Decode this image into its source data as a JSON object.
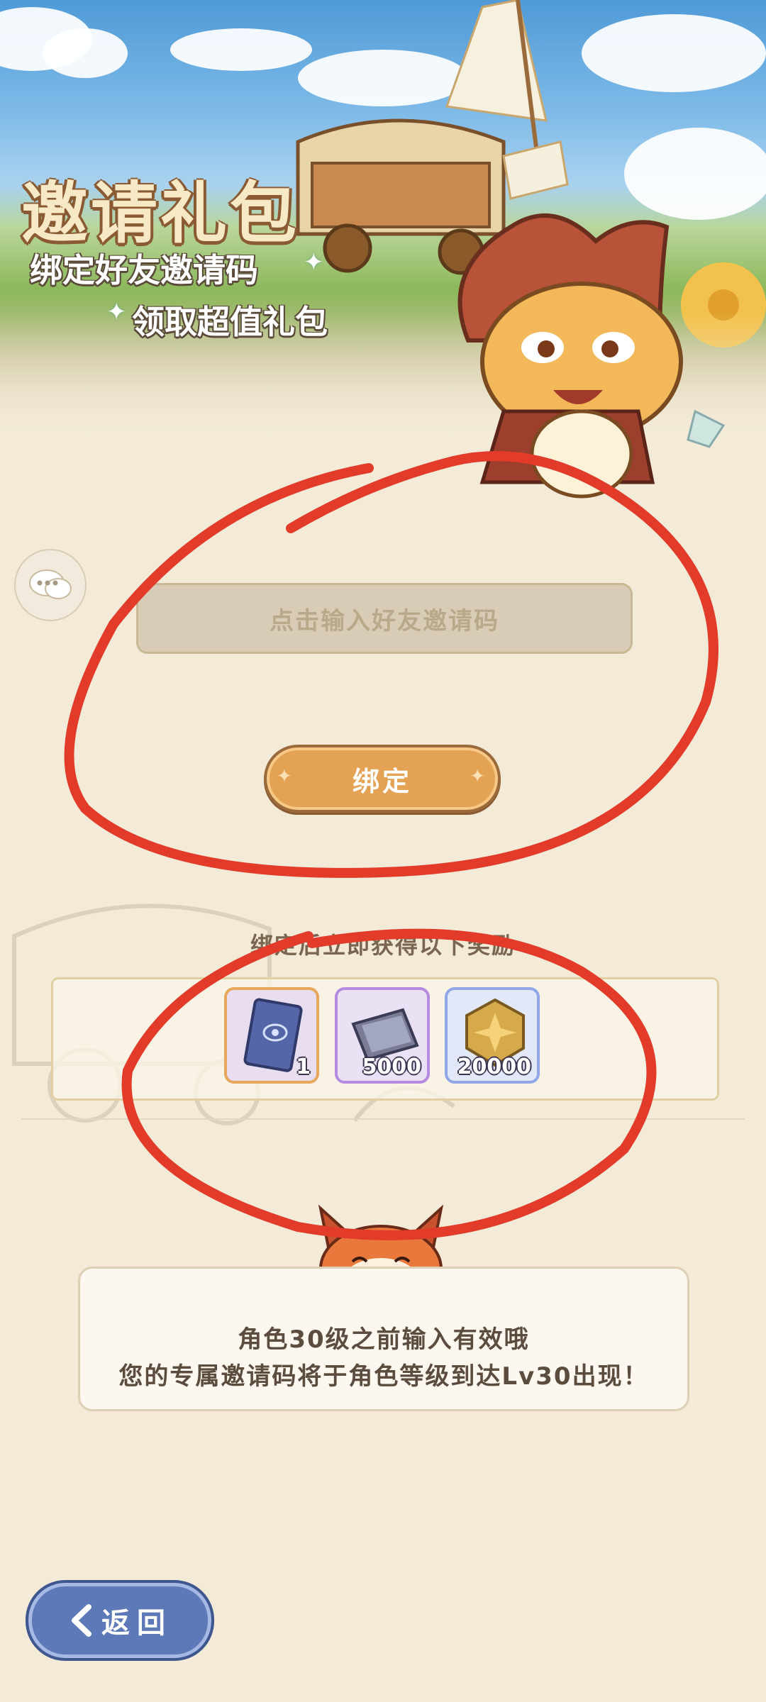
{
  "banner": {
    "title": "邀请礼包",
    "subtitle_line1": "绑定好友邀请码",
    "subtitle_line2": "领取超值礼包"
  },
  "invite": {
    "placeholder": "点击输入好友邀请码",
    "bind_label": "绑定"
  },
  "rewards": {
    "caption": "绑定后立即获得以下奖励",
    "items": [
      {
        "icon": "card-icon",
        "count": "1",
        "frame_color": "#e6a85c"
      },
      {
        "icon": "silver-ingot-icon",
        "count": "5000",
        "frame_color": "#b48be0"
      },
      {
        "icon": "gold-coin-icon",
        "count": "20000",
        "frame_color": "#8fa7e6"
      }
    ]
  },
  "note": {
    "line1": "角色30级之前输入有效哦",
    "line2": "您的专属邀请码将于角色等级到达Lv30出现！"
  },
  "back": {
    "label": "返回"
  },
  "colors": {
    "annotation_red": "#e23b2a",
    "bind_orange": "#e3a254",
    "back_blue": "#5e79b8"
  }
}
